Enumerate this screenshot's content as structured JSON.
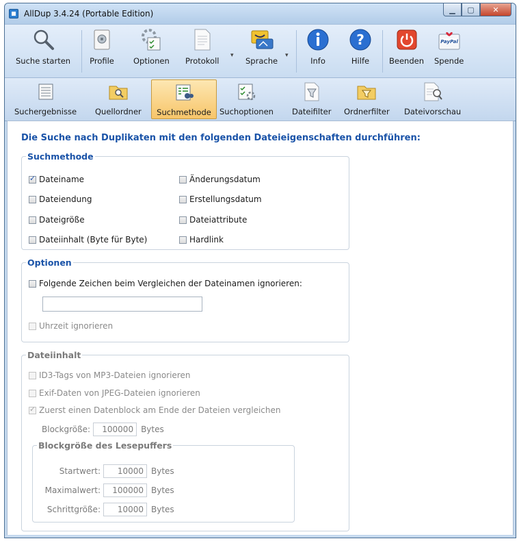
{
  "window": {
    "title": "AllDup 3.4.24 (Portable Edition)"
  },
  "ribbon": {
    "items": [
      {
        "label": "Suche starten",
        "icon": "magnifier-icon"
      },
      {
        "label": "Profile",
        "icon": "profile-icon"
      },
      {
        "label": "Optionen",
        "icon": "options-icon"
      },
      {
        "label": "Protokoll",
        "icon": "log-icon"
      },
      {
        "label": "Sprache",
        "icon": "language-icon"
      },
      {
        "label": "Info",
        "icon": "info-icon"
      },
      {
        "label": "Hilfe",
        "icon": "help-icon"
      },
      {
        "label": "Beenden",
        "icon": "power-icon"
      },
      {
        "label": "Spende",
        "icon": "paypal-icon"
      }
    ]
  },
  "tabs": [
    {
      "label": "Suchergebnisse",
      "icon": "results-icon"
    },
    {
      "label": "Quellordner",
      "icon": "source-folder-icon"
    },
    {
      "label": "Suchmethode",
      "icon": "search-method-icon"
    },
    {
      "label": "Suchoptionen",
      "icon": "search-options-icon"
    },
    {
      "label": "Dateifilter",
      "icon": "file-filter-icon"
    },
    {
      "label": "Ordnerfilter",
      "icon": "folder-filter-icon"
    },
    {
      "label": "Dateivorschau",
      "icon": "file-preview-icon"
    }
  ],
  "active_tab": "Suchmethode",
  "main": {
    "heading": "Die Suche nach Duplikaten mit den folgenden Dateieigenschaften durchführen:",
    "suchmethode": {
      "legend": "Suchmethode",
      "left": [
        {
          "label": "Dateiname",
          "checked": true
        },
        {
          "label": "Dateiendung",
          "checked": false
        },
        {
          "label": "Dateigröße",
          "checked": false
        },
        {
          "label": "Dateiinhalt (Byte für Byte)",
          "checked": false
        }
      ],
      "right": [
        {
          "label": "Änderungsdatum",
          "checked": false
        },
        {
          "label": "Erstellungsdatum",
          "checked": false
        },
        {
          "label": "Dateiattribute",
          "checked": false
        },
        {
          "label": "Hardlink",
          "checked": false
        }
      ]
    },
    "optionen": {
      "legend": "Optionen",
      "ignore_chars_label": "Folgende Zeichen beim Vergleichen der Dateinamen ignorieren:",
      "ignore_chars_value": "",
      "ignore_time_label": "Uhrzeit ignorieren"
    },
    "dateiinhalt": {
      "legend": "Dateiinhalt",
      "id3_label": "ID3-Tags von MP3-Dateien ignorieren",
      "exif_label": "Exif-Daten von JPEG-Dateien ignorieren",
      "block_label": "Zuerst einen Datenblock am Ende der Dateien vergleichen",
      "blocksize_label": "Blockgröße:",
      "blocksize_value": "100000",
      "unit": "Bytes",
      "buffer": {
        "legend": "Blockgröße des Lesepuffers",
        "start_label": "Startwert:",
        "start_value": "10000",
        "max_label": "Maximalwert:",
        "max_value": "100000",
        "step_label": "Schrittgröße:",
        "step_value": "10000"
      }
    }
  },
  "colors": {
    "heading": "#1a53a8",
    "active_tab": "#f7c56a",
    "chrome": "#c5d9ee"
  }
}
